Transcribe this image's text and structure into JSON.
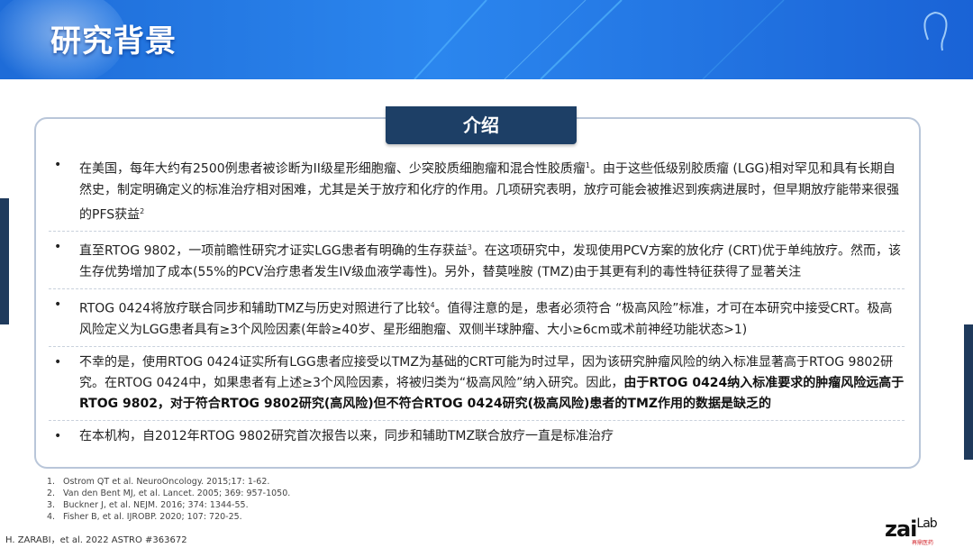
{
  "header": {
    "title": "研究背景"
  },
  "section": {
    "tab_label": "介绍"
  },
  "bullets": [
    {
      "parts": [
        {
          "t": "在美国，每年大约有2500例患者被诊断为II级星形细胞瘤、少突胶质细胞瘤和混合性胶质瘤"
        },
        {
          "t": "1",
          "sup": true
        },
        {
          "t": "。由于这些低级别胶质瘤 (LGG)相对罕见和具有长期自然史，制定明确定义的标准治疗相对困难，尤其是关于放疗和化疗的作用。几项研究表明，放疗可能会被推迟到疾病进展时，但早期放疗能带来很强的PFS获益"
        },
        {
          "t": "2",
          "sup": true
        }
      ]
    },
    {
      "parts": [
        {
          "t": "直至RTOG 9802，一项前瞻性研究才证实LGG患者有明确的生存获益"
        },
        {
          "t": "3",
          "sup": true
        },
        {
          "t": "。在这项研究中，发现使用PCV方案的放化疗 (CRT)优于单纯放疗。然而，该生存优势增加了成本(55%的PCV治疗患者发生IV级血液学毒性)。另外，替莫唑胺 (TMZ)由于其更有利的毒性特征获得了显著关注"
        }
      ]
    },
    {
      "parts": [
        {
          "t": "RTOG 0424将放疗联合同步和辅助TMZ与历史对照进行了比较"
        },
        {
          "t": "4",
          "sup": true
        },
        {
          "t": "。值得注意的是，患者必须符合 “极高风险”标准，才可在本研究中接受CRT。极高风险定义为LGG患者具有≥3个风险因素(年龄≥40岁、星形细胞瘤、双侧半球肿瘤、大小≥6cm或术前神经功能状态>1)"
        }
      ]
    },
    {
      "parts": [
        {
          "t": "不幸的是，使用RTOG 0424证实所有LGG患者应接受以TMZ为基础的CRT可能为时过早，因为该研究肿瘤风险的纳入标准显著高于RTOG 9802研究。在RTOG 0424中，如果患者有上述≥3个风险因素，将被归类为“极高风险”纳入研究。因此，"
        },
        {
          "t": "由于RTOG 0424纳入标准要求的肿瘤风险远高于RTOG 9802，对于符合RTOG 9802研究(高风险)但不符合RTOG 0424研究(极高风险)患者的TMZ作用的数据是缺乏的",
          "bold": true
        }
      ]
    },
    {
      "parts": [
        {
          "t": "在本机构，自2012年RTOG 9802研究首次报告以来，同步和辅助TMZ联合放疗一直是标准治疗"
        }
      ]
    }
  ],
  "references": [
    {
      "n": "1.",
      "text": "Ostrom QT et al. NeuroOncology. 2015;17: 1-62."
    },
    {
      "n": "2.",
      "text": "Van den Bent MJ, et al. Lancet. 2005; 369: 957-1050."
    },
    {
      "n": "3.",
      "text": "Buckner J, et al.  NEJM. 2016; 374: 1344-55."
    },
    {
      "n": "4.",
      "text": "Fisher B, et al. IJROBP. 2020; 107: 720-25."
    }
  ],
  "citation": "H. ZARABI，et al. 2022 ASTRO #363672",
  "logo": {
    "word": "zai",
    "lab": "Lab",
    "sub": "再鼎医药"
  }
}
